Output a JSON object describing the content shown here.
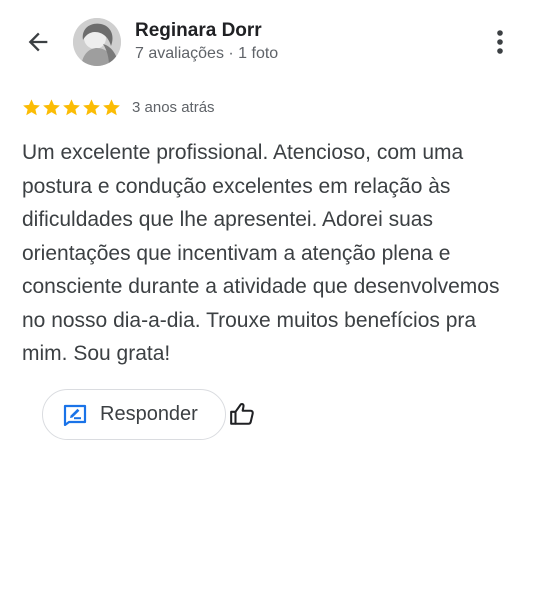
{
  "reviewer": {
    "name": "Reginara Dorr",
    "meta": "7 avaliações · 1 foto"
  },
  "rating": {
    "stars": 5,
    "max_stars": 5,
    "time_ago": "3 anos atrás",
    "star_color": "#fbbc04"
  },
  "review": {
    "text": "Um excelente profissional. Atencioso, com uma postura e condução excelentes em relação às dificuldades que lhe apresentei. Adorei suas orientações que incentivam a atenção plena e consciente durante a atividade que desenvolvemos no nosso dia-a-dia. Trouxe muitos benefícios pra mim. Sou grata!"
  },
  "actions": {
    "reply_label": "Responder",
    "reply_icon": "reply-edit-icon",
    "like_icon": "thumbs-up-icon",
    "accent_color": "#1a73e8"
  },
  "icons": {
    "back": "arrow-back-icon",
    "more": "more-vert-icon"
  }
}
